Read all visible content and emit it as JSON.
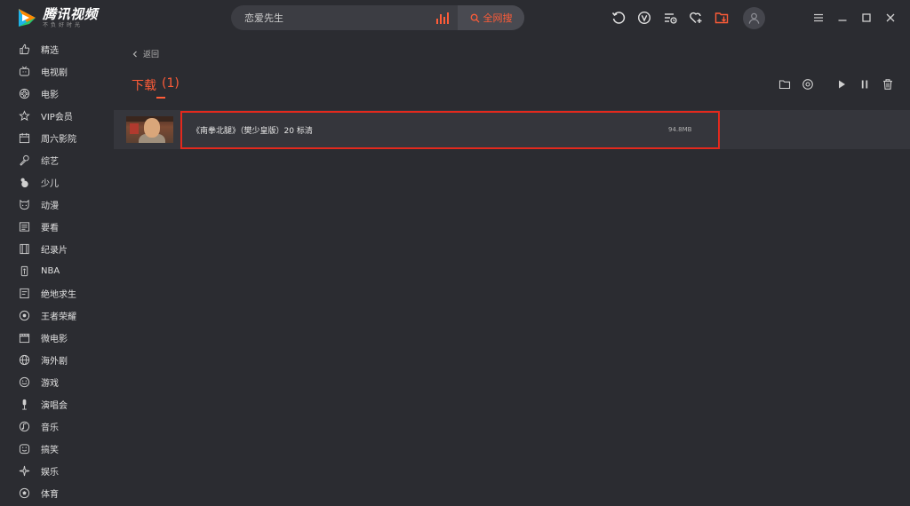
{
  "app": {
    "logo_title": "腾讯视频",
    "logo_slogan": "不负好时光"
  },
  "search": {
    "value": "恋爱先生",
    "button_label": "全网搜"
  },
  "top_icons": [
    "history-icon",
    "vip-v-icon",
    "playlist-icon",
    "favorite-add-icon",
    "download-icon"
  ],
  "window_controls": [
    "menu-icon",
    "minimize-icon",
    "maximize-icon",
    "close-icon"
  ],
  "sidebar": {
    "items": [
      {
        "label": "精选",
        "icon": "thumb-up-icon"
      },
      {
        "label": "电视剧",
        "icon": "tv-icon"
      },
      {
        "label": "电影",
        "icon": "film-reel-icon"
      },
      {
        "label": "VIP会员",
        "icon": "star-icon"
      },
      {
        "label": "周六影院",
        "icon": "calendar-icon"
      },
      {
        "label": "综艺",
        "icon": "microphone-icon"
      },
      {
        "label": "少儿",
        "icon": "kid-icon"
      },
      {
        "label": "动漫",
        "icon": "animal-face-icon"
      },
      {
        "label": "要看",
        "icon": "list-icon"
      },
      {
        "label": "纪录片",
        "icon": "film-strip-icon"
      },
      {
        "label": "NBA",
        "icon": "nba-icon"
      },
      {
        "label": "绝地求生",
        "icon": "game-card-icon"
      },
      {
        "label": "王者荣耀",
        "icon": "target-icon"
      },
      {
        "label": "微电影",
        "icon": "clapper-icon"
      },
      {
        "label": "海外剧",
        "icon": "globe-icon"
      },
      {
        "label": "游戏",
        "icon": "gamepad-icon"
      },
      {
        "label": "演唱会",
        "icon": "mic-stand-icon"
      },
      {
        "label": "音乐",
        "icon": "music-icon"
      },
      {
        "label": "搞笑",
        "icon": "smile-icon"
      },
      {
        "label": "娱乐",
        "icon": "sparkle-icon"
      },
      {
        "label": "体育",
        "icon": "ball-icon"
      }
    ]
  },
  "main": {
    "back_label": "返回",
    "download_title": "下载",
    "download_count": "(1)",
    "tools": [
      "folder-icon",
      "settings-icon",
      "play-all-icon",
      "pause-all-icon",
      "delete-icon"
    ],
    "downloads": [
      {
        "name": "《南拳北腿》（樊少皇版）20 标清",
        "size": "94.8MB"
      }
    ]
  },
  "colors": {
    "accent": "#ff5c38",
    "highlight": "#e3291d",
    "background": "#2b2c31",
    "row": "#35363c"
  }
}
